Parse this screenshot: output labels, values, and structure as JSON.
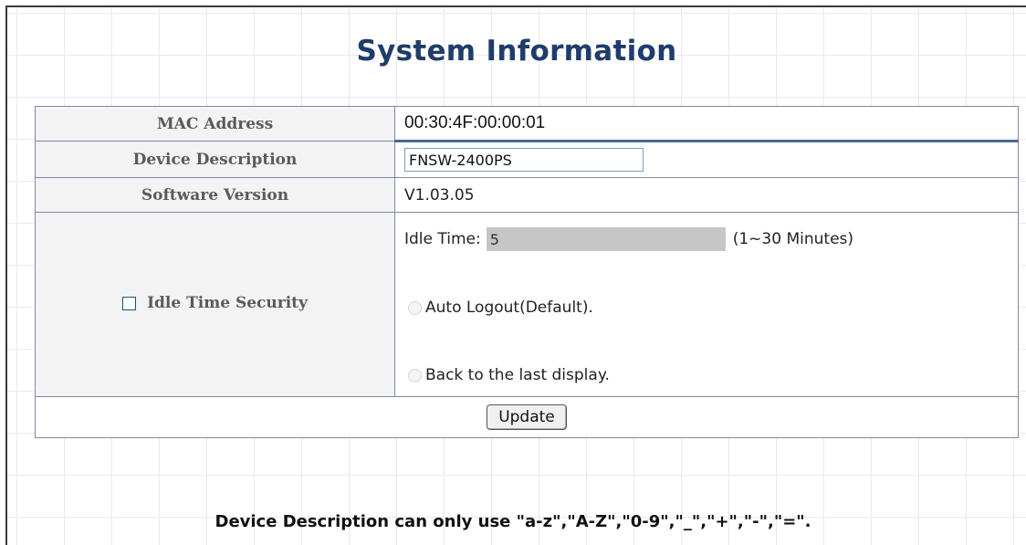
{
  "page": {
    "title": "System Information",
    "note": "Device Description can only use \"a-z\",\"A-Z\",\"0-9\",\"_\",\"+\",\"-\",\"=\"."
  },
  "rows": {
    "mac": {
      "label": "MAC Address",
      "value": "00:30:4F:00:00:01"
    },
    "description": {
      "label": "Device Description",
      "value": "FNSW-2400PS"
    },
    "software": {
      "label": "Software Version",
      "value": "V1.03.05"
    },
    "idle": {
      "label": "Idle Time Security",
      "checked": false,
      "idle_time_label": "Idle Time:",
      "idle_time_value": "5",
      "range_text": "(1~30 Minutes)",
      "option_auto": "Auto Logout(Default).",
      "option_back": "Back to the last display."
    }
  },
  "buttons": {
    "update": "Update"
  },
  "colors": {
    "title": "#1f3d6b",
    "border": "#7c8aa5",
    "label_bg": "#f3f3f3"
  }
}
